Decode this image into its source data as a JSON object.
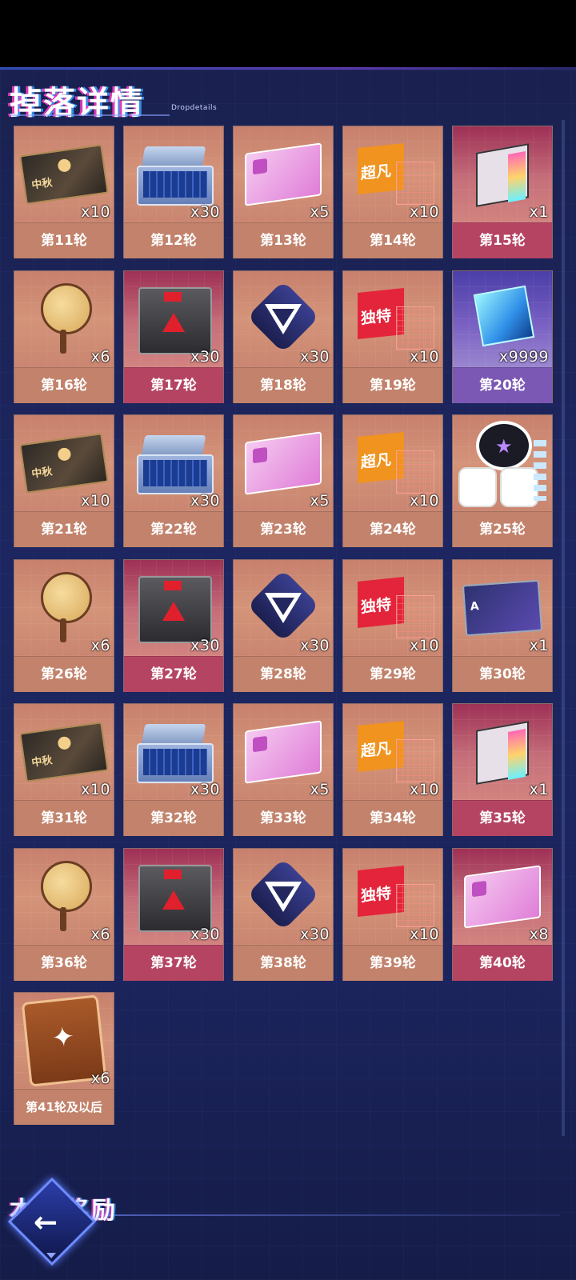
{
  "header": {
    "title": "掉落详情",
    "subtitle": "Dropdetails"
  },
  "rewards": [
    {
      "label": "第11轮",
      "qty": "x10",
      "item": "mooncake-ticket-icon",
      "bg": "orange"
    },
    {
      "label": "第12轮",
      "qty": "x30",
      "item": "blue-case-icon",
      "bg": "orange"
    },
    {
      "label": "第13轮",
      "qty": "x5",
      "item": "pink-card-icon",
      "bg": "orange"
    },
    {
      "label": "第14轮",
      "qty": "x10",
      "item": "orange-flag-icon",
      "flag_text": "超凡",
      "bg": "orange"
    },
    {
      "label": "第15轮",
      "qty": "x1",
      "item": "chip-card-icon",
      "bg": "red"
    },
    {
      "label": "第16轮",
      "qty": "x6",
      "item": "fan-icon",
      "bg": "orange"
    },
    {
      "label": "第17轮",
      "qty": "x30",
      "item": "crate-icon",
      "bg": "red"
    },
    {
      "label": "第18轮",
      "qty": "x30",
      "item": "triangle-core-icon",
      "bg": "orange"
    },
    {
      "label": "第19轮",
      "qty": "x10",
      "item": "red-flag-icon",
      "flag_text": "独特",
      "bg": "orange"
    },
    {
      "label": "第20轮",
      "qty": "x9999",
      "item": "cube-icon",
      "bg": "purple"
    },
    {
      "label": "第21轮",
      "qty": "x10",
      "item": "mooncake-ticket-icon",
      "bg": "orange"
    },
    {
      "label": "第22轮",
      "qty": "x30",
      "item": "blue-case-icon",
      "bg": "orange"
    },
    {
      "label": "第23轮",
      "qty": "x5",
      "item": "pink-card-icon",
      "bg": "orange"
    },
    {
      "label": "第24轮",
      "qty": "x10",
      "item": "orange-flag-icon",
      "flag_text": "超凡",
      "bg": "orange"
    },
    {
      "label": "第25轮",
      "qty": "",
      "item": "mascot-icon",
      "bg": "orange"
    },
    {
      "label": "第26轮",
      "qty": "x6",
      "item": "fan-icon",
      "bg": "orange"
    },
    {
      "label": "第27轮",
      "qty": "x30",
      "item": "crate-icon",
      "bg": "red"
    },
    {
      "label": "第28轮",
      "qty": "x30",
      "item": "triangle-core-icon",
      "bg": "orange"
    },
    {
      "label": "第29轮",
      "qty": "x10",
      "item": "red-flag-icon",
      "flag_text": "独特",
      "bg": "orange"
    },
    {
      "label": "第30轮",
      "qty": "x1",
      "item": "pass-card-icon",
      "bg": "orange"
    },
    {
      "label": "第31轮",
      "qty": "x10",
      "item": "mooncake-ticket-icon",
      "bg": "orange"
    },
    {
      "label": "第32轮",
      "qty": "x30",
      "item": "blue-case-icon",
      "bg": "orange"
    },
    {
      "label": "第33轮",
      "qty": "x5",
      "item": "pink-card-icon",
      "bg": "orange"
    },
    {
      "label": "第34轮",
      "qty": "x10",
      "item": "orange-flag-icon",
      "flag_text": "超凡",
      "bg": "orange"
    },
    {
      "label": "第35轮",
      "qty": "x1",
      "item": "chip-card-icon",
      "bg": "red"
    },
    {
      "label": "第36轮",
      "qty": "x6",
      "item": "fan-icon",
      "bg": "orange"
    },
    {
      "label": "第37轮",
      "qty": "x30",
      "item": "crate-icon",
      "bg": "red"
    },
    {
      "label": "第38轮",
      "qty": "x30",
      "item": "triangle-core-icon",
      "bg": "orange"
    },
    {
      "label": "第39轮",
      "qty": "x10",
      "item": "red-flag-icon",
      "flag_text": "独特",
      "bg": "orange"
    },
    {
      "label": "第40轮",
      "qty": "x8",
      "item": "pink-card-icon",
      "bg": "red"
    },
    {
      "label": "第41轮及以后",
      "qty": "x6",
      "item": "emblem-card-icon",
      "bg": "orange"
    }
  ],
  "footer": {
    "section_title": "本轮奖励",
    "back_label": "←"
  }
}
